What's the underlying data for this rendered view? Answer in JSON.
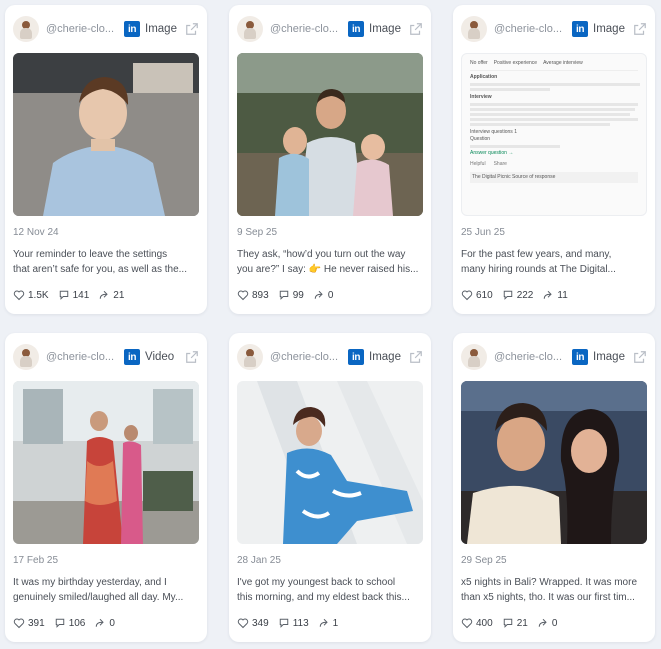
{
  "posts": [
    {
      "handle": "@cherie-clo...",
      "type": "Image",
      "date": "12 Nov 24",
      "text": [
        "Your reminder to leave the settings",
        "that aren’t safe for you, as well as the..."
      ],
      "likes": "1.5K",
      "comments": "141",
      "shares": "21"
    },
    {
      "handle": "@cherie-clo...",
      "type": "Image",
      "date": "9 Sep 25",
      "text": [
        "They ask, “how’d you turn out the way",
        "you are?” I say: 👉 He never raised his..."
      ],
      "likes": "893",
      "comments": "99",
      "shares": "0"
    },
    {
      "handle": "@cherie-clo...",
      "type": "Image",
      "date": "25 Jun 25",
      "text": [
        "For the past few years, and many,",
        "many hiring rounds at The Digital..."
      ],
      "likes": "610",
      "comments": "222",
      "shares": "11"
    },
    {
      "handle": "@cherie-clo...",
      "type": "Video",
      "date": "17 Feb 25",
      "text": [
        "It was my birthday yesterday, and I",
        "genuinely smiled/laughed all day. My..."
      ],
      "likes": "391",
      "comments": "106",
      "shares": "0"
    },
    {
      "handle": "@cherie-clo...",
      "type": "Image",
      "date": "28 Jan 25",
      "text": [
        "I've got my youngest back to school",
        "this morning, and my eldest back this..."
      ],
      "likes": "349",
      "comments": "113",
      "shares": "1"
    },
    {
      "handle": "@cherie-clo...",
      "type": "Image",
      "date": "29 Sep 25",
      "text": [
        "x5 nights in Bali? Wrapped. It was more",
        "than x5 nights, tho. It was our first tim..."
      ],
      "likes": "400",
      "comments": "21",
      "shares": "0"
    }
  ],
  "linkedin_badge": "in",
  "colors": {
    "linkedin": "#0a66c2",
    "card": "#ffffff",
    "page_bg": "#eef1f6",
    "ai_link": "#0a8a5a"
  },
  "doc_preview": {
    "status_items": [
      "No offer",
      "Positive experience",
      "Average interview"
    ],
    "heading_1": "Application",
    "heading_2": "Interview",
    "questions_label": "Interview questions  1",
    "question_prefix": "Question",
    "answer_link": "Answer question  →",
    "help_label": "Helpful",
    "share_label": "Share",
    "response_label": "The Digital Picnic Source of response"
  },
  "icons": [
    "avatar",
    "linkedin-icon",
    "external-link-icon",
    "heart-icon",
    "comment-icon",
    "share-icon"
  ]
}
